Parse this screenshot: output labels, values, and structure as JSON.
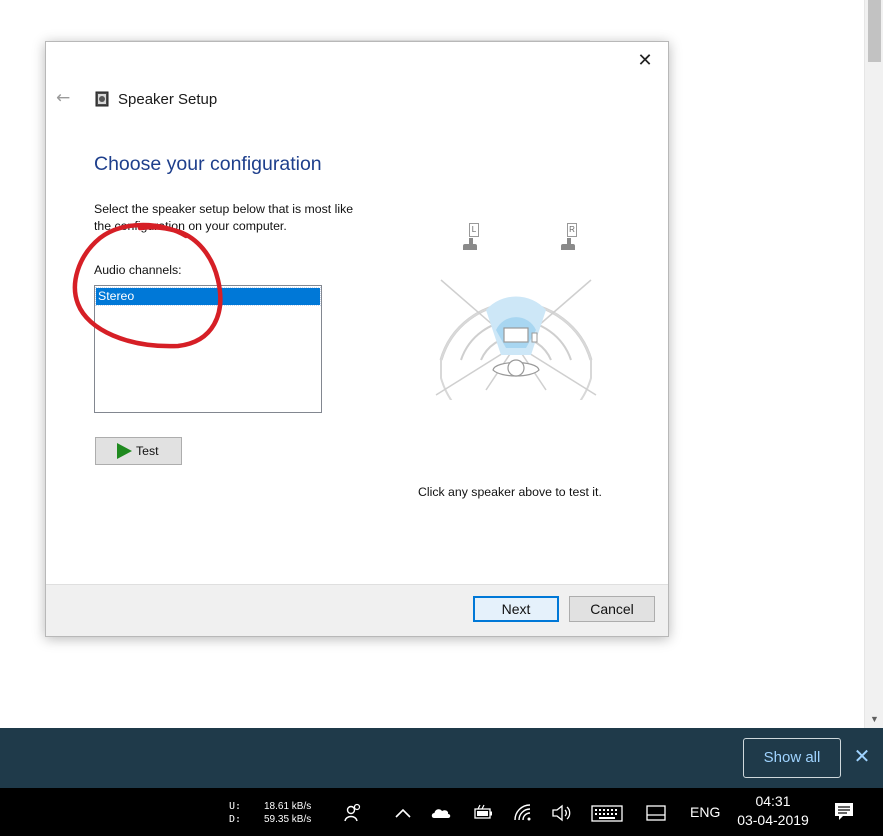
{
  "dialog": {
    "title": "Speaker Setup",
    "close_glyph": "✕",
    "back_glyph": "←",
    "heading": "Choose your configuration",
    "instructions_line1": "Select the speaker setup below that is most like",
    "instructions_line2": "the configuration on your computer.",
    "channels_label": "Audio channels:",
    "channels": [
      "Stereo"
    ],
    "selected_channel": "Stereo",
    "test_label": "Test",
    "speaker_left": "L",
    "speaker_right": "R",
    "hint": "Click any speaker above to test it.",
    "next_label": "Next",
    "cancel_label": "Cancel"
  },
  "notification": {
    "show_all_label": "Show all",
    "close_glyph": "✕"
  },
  "taskbar": {
    "upload_label": "U:",
    "download_label": "D:",
    "upload_speed": "18.61 kB/s",
    "download_speed": "59.35 kB/s",
    "language": "ENG",
    "time": "04:31",
    "date": "03-04-2019"
  },
  "colors": {
    "heading": "#1e3f8c",
    "selection": "#0078d7",
    "annotation": "#d61f26",
    "notify_bar": "#1f3a4a",
    "show_all_text": "#9fd3ff"
  },
  "icons": [
    "back-arrow-icon",
    "speaker-setup-icon",
    "close-icon",
    "play-icon",
    "people-icon",
    "chevron-up-icon",
    "onedrive-cloud-icon",
    "battery-charging-icon",
    "wifi-icon",
    "volume-icon",
    "keyboard-icon",
    "tablet-mode-icon",
    "action-center-icon"
  ]
}
